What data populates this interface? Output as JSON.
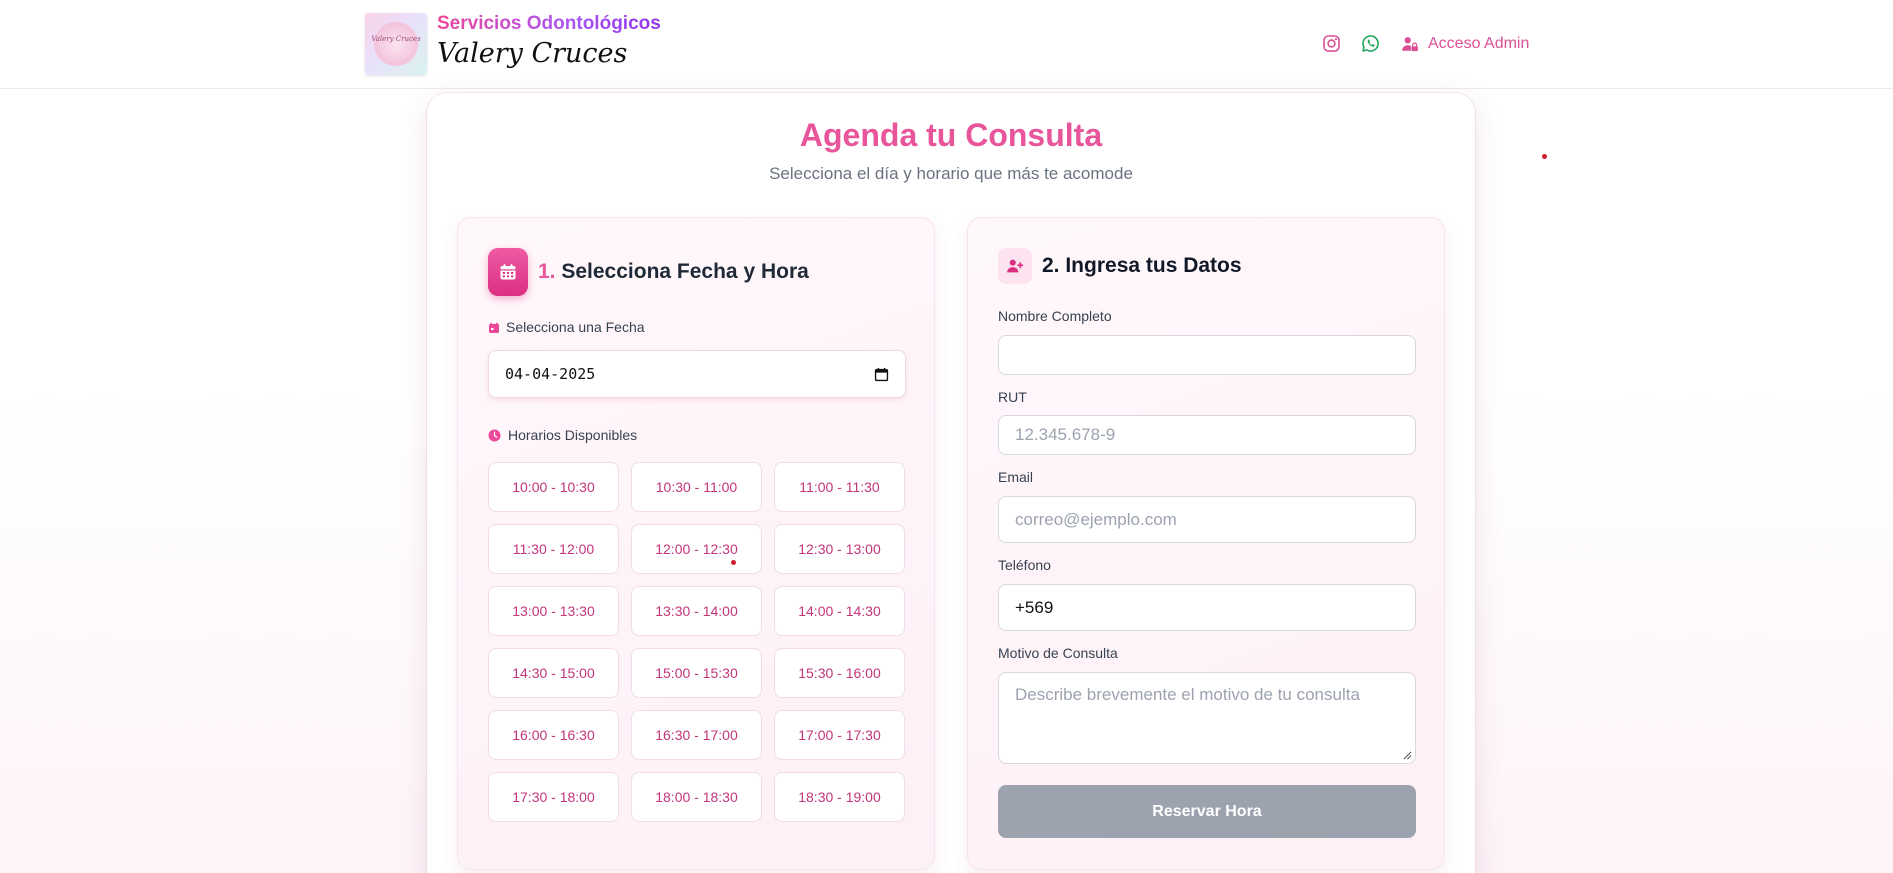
{
  "header": {
    "brand_top": "Servicios Odontológicos",
    "brand_name": "Valery Cruces",
    "logo_text": "Valery Cruces",
    "admin_label": "Acceso Admin",
    "icons": [
      "instagram-icon",
      "whatsapp-icon",
      "user-lock-icon"
    ]
  },
  "main": {
    "title": "Agenda tu Consulta",
    "subtitle": "Selecciona el día y horario que más te acomode"
  },
  "step1": {
    "number": "1.",
    "title": "Selecciona Fecha y Hora",
    "date_label": "Selecciona una Fecha",
    "date_value": "04-04-2025",
    "slots_label": "Horarios Disponibles",
    "slots": [
      "10:00 - 10:30",
      "10:30 - 11:00",
      "11:00 - 11:30",
      "11:30 - 12:00",
      "12:00 - 12:30",
      "12:30 - 13:00",
      "13:00 - 13:30",
      "13:30 - 14:00",
      "14:00 - 14:30",
      "14:30 - 15:00",
      "15:00 - 15:30",
      "15:30 - 16:00",
      "16:00 - 16:30",
      "16:30 - 17:00",
      "17:00 - 17:30",
      "17:30 - 18:00",
      "18:00 - 18:30",
      "18:30 - 19:00"
    ]
  },
  "step2": {
    "title": "2. Ingresa tus Datos",
    "name_label": "Nombre Completo",
    "name_value": "",
    "rut_label": "RUT",
    "rut_placeholder": "12.345.678-9",
    "email_label": "Email",
    "email_placeholder": "correo@ejemplo.com",
    "phone_label": "Teléfono",
    "phone_value": "+569",
    "reason_label": "Motivo de Consulta",
    "reason_placeholder": "Describe brevemente el motivo de tu consulta",
    "submit_label": "Reservar Hora"
  },
  "colors": {
    "accent": "#e8559b",
    "slot_text": "#c2357a",
    "button_disabled": "#9ca3af",
    "whatsapp": "#25a55b"
  }
}
